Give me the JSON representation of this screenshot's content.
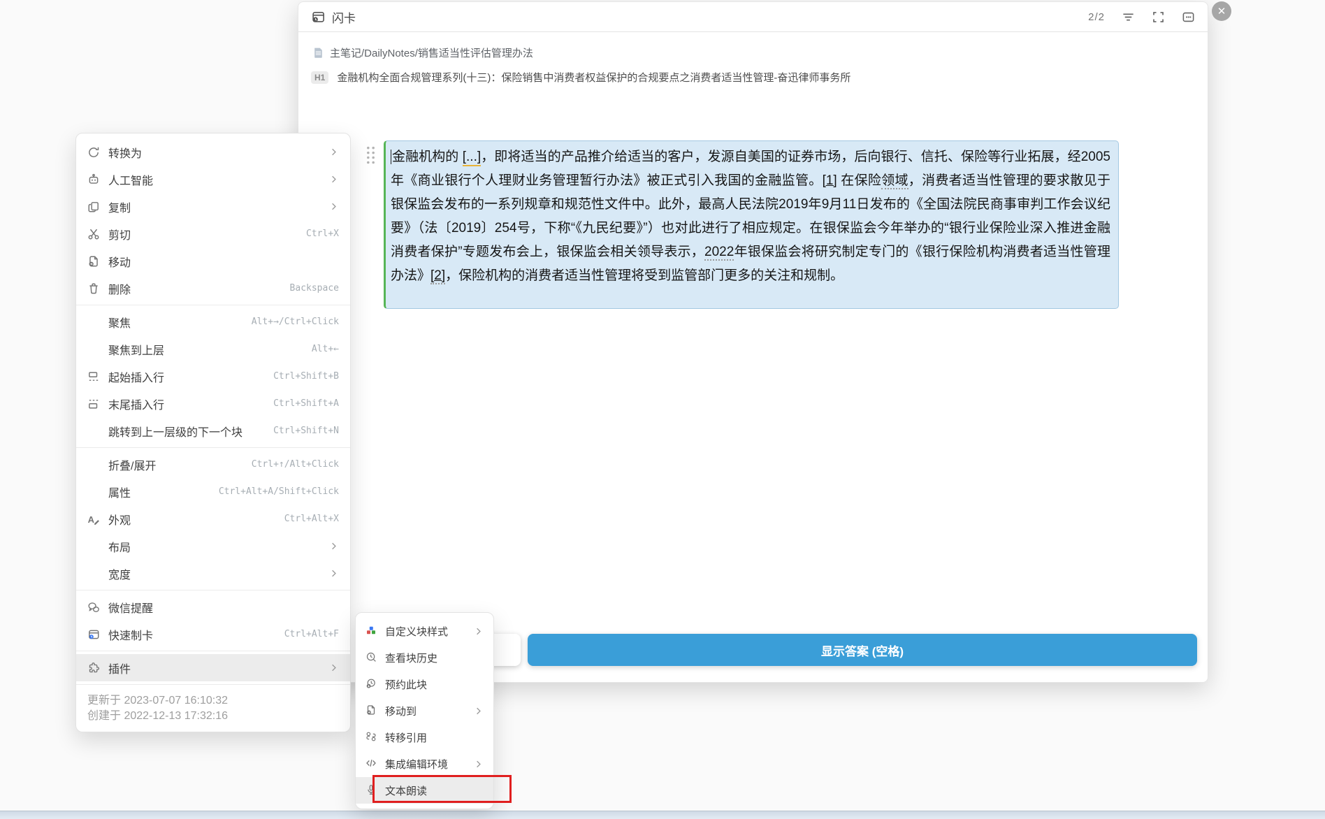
{
  "colors": {
    "accent_blue": "#3a9ed8",
    "block_bg": "#d8e9f6",
    "block_border_green": "#56b556",
    "annotation_red": "#e01f1f"
  },
  "dialog": {
    "title": "闪卡",
    "counter": "2/2",
    "breadcrumb": "主笔记/DailyNotes/销售适当性评估管理办法",
    "heading_badge": "H1",
    "heading": "金融机构全面合规管理系列(十三)：保险销售中消费者权益保护的合规要点之消费者适当性管理-奋迅律师事务所",
    "show_answer_button": "显示答案 (空格)",
    "card_block_segments": [
      {
        "text": "金融机构的 "
      },
      {
        "text": "[...]",
        "style": "cloze"
      },
      {
        "text": "，即将适当的产品推介给适当的客户，发源自美国的证券市场，后向银行、信托、保险等行业拓展，经2005年《商业银行个人理财业务管理暂行办法》被正式引入我国的金融监管。"
      },
      {
        "text": "[1]",
        "style": "link"
      },
      {
        "text": " 在保险"
      },
      {
        "text": "领域",
        "style": "dashed"
      },
      {
        "text": "，消费者适当性管理的要求散见于银保监会发布的一系列规章和规范性文件中。此外，最高人民法院2019年9月11日发布的《全国法院民商事审判工作会议纪要》（法〔2019〕254号，下称“《九民纪要》”）也对此进行了相应规定。在银保监会今年举办的“银行业保险业深入推进金融消费者保护”专题发布会上，银保监会相关领导表示，"
      },
      {
        "text": "2022",
        "style": "dashed"
      },
      {
        "text": "年银保监会将研究制定专门的《银行保险机构消费者适当性管理办法》"
      },
      {
        "text": "[2]",
        "style": "link-dashed"
      },
      {
        "text": "，保险机构的消费者适当性管理将受到监管部门更多的关注和规制。"
      }
    ]
  },
  "context_menu": {
    "sections": [
      [
        {
          "name": "convert-to",
          "icon": "convert-icon",
          "label": "转换为",
          "arrow": true
        },
        {
          "name": "ai",
          "icon": "ai-icon",
          "label": "人工智能",
          "arrow": true
        },
        {
          "name": "copy",
          "icon": "copy-icon",
          "label": "复制",
          "arrow": true
        },
        {
          "name": "cut",
          "icon": "cut-icon",
          "label": "剪切",
          "shortcut": "Ctrl+X"
        },
        {
          "name": "move",
          "icon": "move-icon",
          "label": "移动"
        },
        {
          "name": "delete",
          "icon": "delete-icon",
          "label": "删除",
          "shortcut": "Backspace"
        }
      ],
      [
        {
          "name": "focus",
          "label": "聚焦",
          "shortcut": "Alt+→/Ctrl+Click"
        },
        {
          "name": "focus-parent",
          "label": "聚焦到上层",
          "shortcut": "Alt+←"
        },
        {
          "name": "insert-line-start",
          "icon": "insert-before-icon",
          "label": "起始插入行",
          "shortcut": "Ctrl+Shift+B"
        },
        {
          "name": "insert-line-end",
          "icon": "insert-after-icon",
          "label": "末尾插入行",
          "shortcut": "Ctrl+Shift+A"
        },
        {
          "name": "jump-next-block",
          "label": "跳转到上一层级的下一个块",
          "shortcut": "Ctrl+Shift+N"
        }
      ],
      [
        {
          "name": "fold-toggle",
          "label": "折叠/展开",
          "shortcut": "Ctrl+↑/Alt+Click"
        },
        {
          "name": "attributes",
          "label": "属性",
          "shortcut": "Ctrl+Alt+A/Shift+Click"
        },
        {
          "name": "appearance",
          "icon": "appearance-icon",
          "label": "外观",
          "shortcut": "Ctrl+Alt+X"
        },
        {
          "name": "layout",
          "label": "布局",
          "arrow": true
        },
        {
          "name": "width",
          "label": "宽度",
          "arrow": true
        }
      ],
      [
        {
          "name": "wechat-reminder",
          "icon": "wechat-icon",
          "label": "微信提醒"
        },
        {
          "name": "quick-flashcard",
          "icon": "quickcard-icon",
          "label": "快速制卡",
          "shortcut": "Ctrl+Alt+F"
        }
      ],
      [
        {
          "name": "plugin",
          "icon": "plugin-icon",
          "label": "插件",
          "arrow": true,
          "highlighted": true
        }
      ]
    ],
    "footer": [
      "更新于 2023-07-07 16:10:32",
      "创建于 2022-12-13 17:32:16"
    ]
  },
  "plugin_submenu": {
    "items": [
      {
        "name": "custom-block-style",
        "icon": "block-style-icon",
        "label": "自定义块样式",
        "arrow": true
      },
      {
        "name": "view-block-history",
        "icon": "history-icon",
        "label": "查看块历史"
      },
      {
        "name": "schedule-block",
        "icon": "schedule-icon",
        "label": "预约此块"
      },
      {
        "name": "move-to",
        "icon": "move-to-icon",
        "label": "移动到",
        "arrow": true
      },
      {
        "name": "transfer-reference",
        "icon": "transfer-ref-icon",
        "label": "转移引用"
      },
      {
        "name": "ide",
        "icon": "ide-icon",
        "label": "集成编辑环境",
        "arrow": true
      },
      {
        "name": "tts",
        "icon": "tts-icon",
        "label": "文本朗读",
        "highlighted": true
      }
    ]
  },
  "close_button": "✕"
}
